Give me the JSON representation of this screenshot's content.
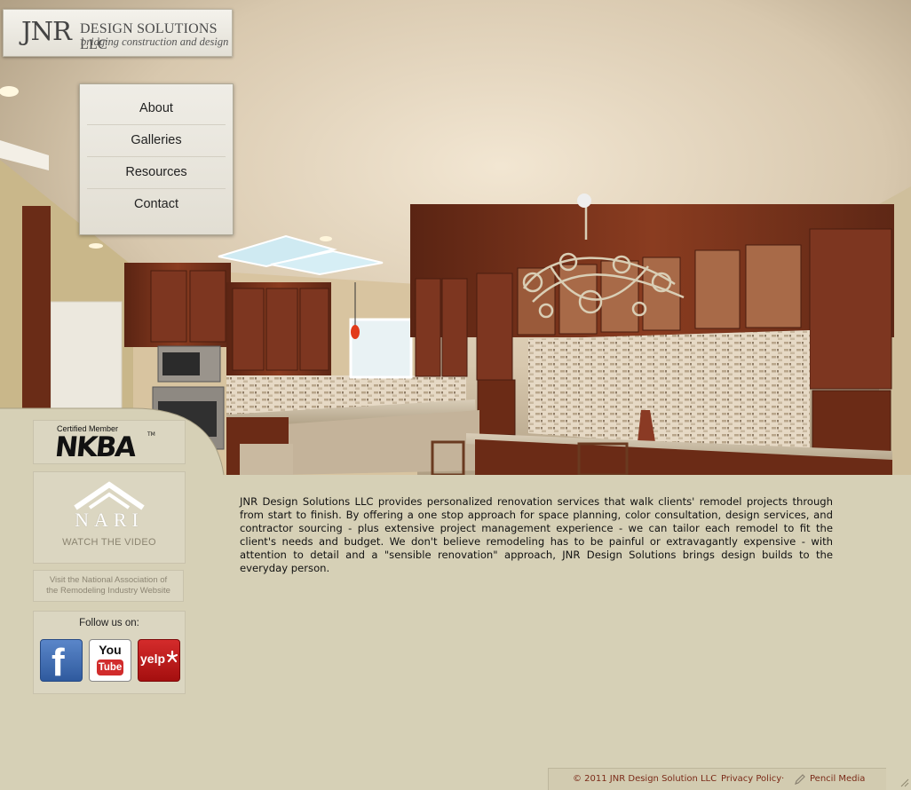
{
  "logo": {
    "mark": "JNR",
    "company": "DESIGN SOLUTIONS LLC",
    "tagline": "bridging construction and design"
  },
  "nav": {
    "items": [
      {
        "label": "About"
      },
      {
        "label": "Galleries"
      },
      {
        "label": "Resources"
      },
      {
        "label": "Contact"
      }
    ]
  },
  "sidebar": {
    "nkba": {
      "caption": "Certified Member",
      "logo_text": "NKBA",
      "tm": "TM"
    },
    "nari": {
      "name": "NARI",
      "cta": "WATCH THE VIDEO"
    },
    "nari_link": {
      "line1": "Visit the National Association of",
      "line2": "the  Remodeling Industry Website"
    },
    "social": {
      "label": "Follow us on:",
      "facebook": {
        "icon": "facebook-icon",
        "glyph": "f"
      },
      "youtube": {
        "icon": "youtube-icon",
        "you": "You",
        "tube": "Tube"
      },
      "yelp": {
        "icon": "yelp-icon",
        "text": "yelp"
      }
    }
  },
  "main": {
    "intro": "JNR Design Solutions LLC provides personalized renovation services that walk clients' remodel projects through from start to finish. By offering a one stop approach for space planning, color consultation, design services, and contractor sourcing - plus extensive project management experience - we can tailor each remodel to fit the client's needs and budget. We don't believe remodeling has to be painful or extravagantly expensive - with attention to detail and a \"sensible renovation\" approach, JNR Design Solutions brings design builds to the everyday person."
  },
  "footer": {
    "copyright": "© 2011 JNR Design Solution LLC",
    "separator": "·",
    "privacy": "Privacy Policy",
    "credit": "Pencil Media"
  },
  "colors": {
    "page_bg": "#d6d0b6",
    "footer_link": "#7a2a18",
    "cabinet": "#6e2f1a"
  }
}
